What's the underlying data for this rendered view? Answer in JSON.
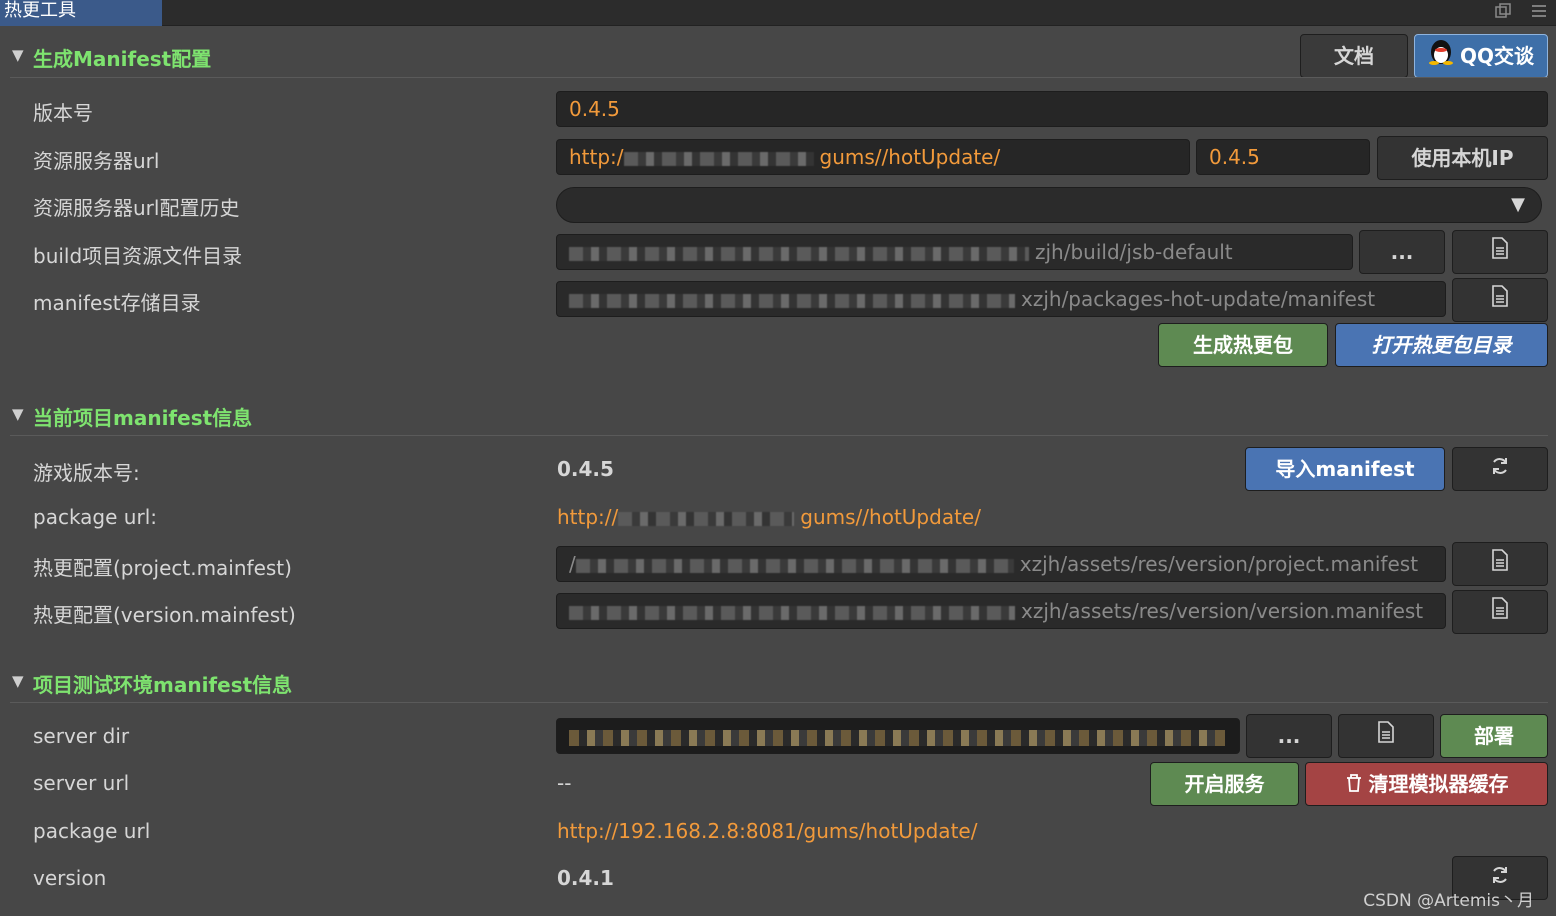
{
  "window": {
    "tab_title": "热更工具"
  },
  "icons": {
    "restore": "restore-window-icon",
    "menu": "hamburger-menu-icon",
    "file": "file-icon",
    "refresh": "refresh-icon",
    "trash": "trash-icon",
    "qq": "qq-penguin-icon"
  },
  "colors": {
    "section_title": "#7ee36f",
    "accent_value": "#f29a3b",
    "green_button": "#5e8a52",
    "blue_button": "#4a74b3",
    "red_button": "#a44444"
  },
  "section1": {
    "title": "生成Manifest配置",
    "doc_button": "文档",
    "qq_button": "QQ交谈",
    "version_label": "版本号",
    "version_value": "0.4.5",
    "server_url_label": "资源服务器url",
    "server_url_prefix": "http:/",
    "server_url_suffix": "gums//hotUpdate/",
    "server_url_version": "0.4.5",
    "use_local_ip": "使用本机IP",
    "url_history_label": "资源服务器url配置历史",
    "build_dir_label": "build项目资源文件目录",
    "build_dir_suffix": "zjh/build/jsb-default",
    "browse_label": "...",
    "manifest_dir_label": "manifest存储目录",
    "manifest_dir_suffix": "xzjh/packages-hot-update/manifest",
    "generate_button": "生成热更包",
    "open_dir_button": "打开热更包目录"
  },
  "section2": {
    "title": "当前项目manifest信息",
    "game_version_label": "游戏版本号:",
    "game_version_value": "0.4.5",
    "import_button": "导入manifest",
    "package_url_label": "package url:",
    "package_url_prefix": "http://",
    "package_url_suffix": "gums//hotUpdate/",
    "project_manifest_label": "热更配置(project.mainfest)",
    "project_manifest_prefix": "/",
    "project_manifest_suffix": "xzjh/assets/res/version/project.manifest",
    "version_manifest_label": "热更配置(version.mainfest)",
    "version_manifest_suffix": "xzjh/assets/res/version/version.manifest"
  },
  "section3": {
    "title": "项目测试环境manifest信息",
    "server_dir_label": "server dir",
    "browse_label": "...",
    "deploy_button": "部署",
    "server_url_label": "server url",
    "server_url_value": "--",
    "start_service_button": "开启服务",
    "clear_cache_button": "清理模拟器缓存",
    "package_url_label": "package url",
    "package_url_value": "http://192.168.2.8:8081/gums/hotUpdate/",
    "version_label": "version",
    "version_value": "0.4.1"
  },
  "watermark": "CSDN @Artemis丶月"
}
